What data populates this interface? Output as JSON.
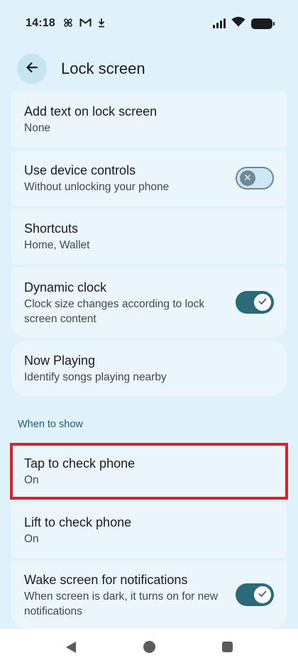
{
  "status_bar": {
    "time": "14:18",
    "notification_icons": [
      "pinwheel-icon",
      "gmail-icon",
      "download-icon"
    ]
  },
  "app_bar": {
    "title": "Lock screen",
    "back_icon": "arrow-left-icon"
  },
  "settings": {
    "add_text": {
      "title": "Add text on lock screen",
      "subtitle": "None"
    },
    "device_controls": {
      "title": "Use device controls",
      "subtitle": "Without unlocking your phone",
      "enabled": false
    },
    "shortcuts": {
      "title": "Shortcuts",
      "subtitle": "Home, Wallet"
    },
    "dynamic_clock": {
      "title": "Dynamic clock",
      "subtitle": "Clock size changes according to lock screen content",
      "enabled": true
    },
    "now_playing": {
      "title": "Now Playing",
      "subtitle": "Identify songs playing nearby"
    }
  },
  "when_to_show": {
    "header": "When to show",
    "tap_to_check": {
      "title": "Tap to check phone",
      "subtitle": "On"
    },
    "lift_to_check": {
      "title": "Lift to check phone",
      "subtitle": "On"
    },
    "wake_screen": {
      "title": "Wake screen for notifications",
      "subtitle": "When screen is dark, it turns on for new notifications",
      "enabled": true
    }
  },
  "colors": {
    "background": "#dff1fb",
    "card": "#eaf6fc",
    "accent": "#2b6a78",
    "highlight": "#d9222c"
  }
}
